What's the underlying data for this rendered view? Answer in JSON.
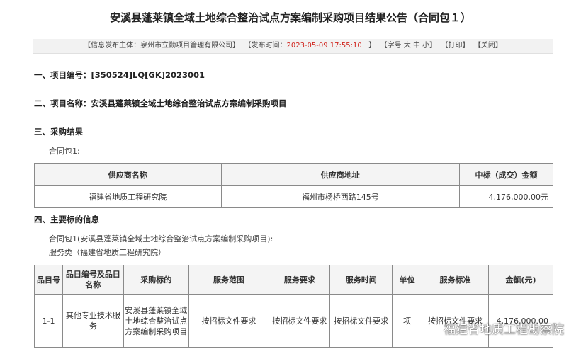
{
  "title": "安溪县蓬莱镇全域土地综合整治试点方案编制采购项目结果公告（合同包１）",
  "infobar": {
    "publisher_prefix": "【信息发布主体：",
    "publisher": "泉州市立勤项目管理有限公司】",
    "time_prefix": "【发布时间：",
    "time": "2023-05-09 17:55:10",
    "time_suffix": "】",
    "font_size": "【字号 大 中 小】",
    "print": "【打印】",
    "close": "【关闭】"
  },
  "sections": {
    "s1": "一、项目编号：[350524]LQ[GK]2023001",
    "s2": "二、项目名称：安溪县蓬莱镇全域土地综合整治试点方案编制采购项目",
    "s3": "三、采购结果",
    "s3_sub": "合同包1:",
    "s4": "四、主要标的信息",
    "s4_sub1": "合同包1(安溪县蓬莱镇全域土地综合整治试点方案编制采购项目):",
    "s4_sub2": "服务类（福建省地质工程研究院）"
  },
  "result_table": {
    "headers": [
      "供应商名称",
      "供应商地址",
      "中标（成交）金额"
    ],
    "rows": [
      [
        "福建省地质工程研究院",
        "福州市杨桥西路145号",
        "4,176,000.00元"
      ]
    ]
  },
  "item_table": {
    "headers": [
      "品目号",
      "品目编号及品目名称",
      "采购标的",
      "服务范围",
      "服务要求",
      "服务时间",
      "单位",
      "服务标准",
      "金额(元)"
    ],
    "rows": [
      [
        "1-1",
        "其他专业技术服务",
        "安溪县蓬莱镇全域土地综合整治试点方案编制采购项目",
        "按招标文件要求",
        "按招标文件要求",
        "按招标文件要求",
        "项",
        "按招标文件要求",
        "4,176,000.00"
      ]
    ]
  },
  "watermark": {
    "icon": "wechat-icon",
    "text": "福建省地质工程勘察院"
  }
}
